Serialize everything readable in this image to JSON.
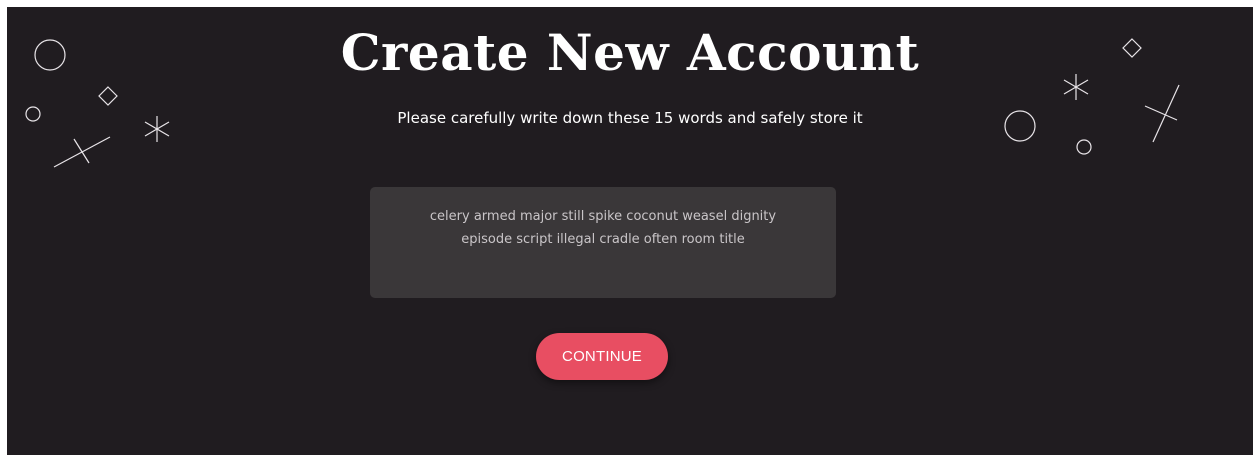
{
  "page": {
    "title": "Create New Account",
    "instruction": "Please carefully write down these 15 words and safely store it"
  },
  "recovery_phrase": {
    "line_1": "celery armed major still spike coconut weasel dignity",
    "line_2": "episode script illegal cradle often room title"
  },
  "actions": {
    "continue_label": "CONTINUE"
  },
  "colors": {
    "background": "#201c20",
    "phrase_box": "#3a3739",
    "accent": "#e84e62",
    "text": "#ffffff",
    "phrase_text": "#c9c5c8"
  }
}
